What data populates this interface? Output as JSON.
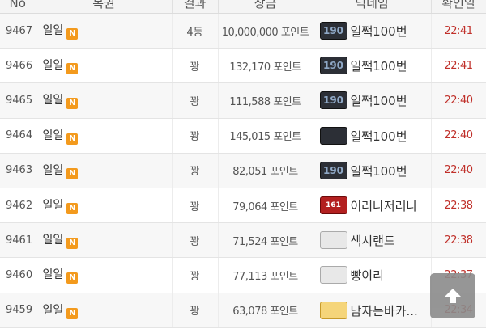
{
  "header": {
    "no": "No",
    "lottery": "복권",
    "result": "결과",
    "prize": "상금",
    "nickname": "닉네임",
    "confirm_time": "확인일"
  },
  "rows": [
    {
      "no": "9467",
      "lottery": "일일",
      "badge": "N",
      "result": "4등",
      "prize": "10,000,000 포인트",
      "level_icon": "level-190-dark",
      "nickname": "일짹100번",
      "time": "22:41"
    },
    {
      "no": "9466",
      "lottery": "일일",
      "badge": "N",
      "result": "꽝",
      "prize": "132,170 포인트",
      "level_icon": "level-190-dark",
      "nickname": "일짹100번",
      "time": "22:41"
    },
    {
      "no": "9465",
      "lottery": "일일",
      "badge": "N",
      "result": "꽝",
      "prize": "111,588 포인트",
      "level_icon": "level-190-dark",
      "nickname": "일짹100번",
      "time": "22:40"
    },
    {
      "no": "9464",
      "lottery": "일일",
      "badge": "N",
      "result": "꽝",
      "prize": "145,015 포인트",
      "level_icon": "level-dark",
      "nickname": "일짹100번",
      "time": "22:40"
    },
    {
      "no": "9463",
      "lottery": "일일",
      "badge": "N",
      "result": "꽝",
      "prize": "82,051 포인트",
      "level_icon": "level-190-dark",
      "nickname": "일짹100번",
      "time": "22:40"
    },
    {
      "no": "9462",
      "lottery": "일일",
      "badge": "N",
      "result": "꽝",
      "prize": "79,064 포인트",
      "level_icon": "level-161-red",
      "nickname": "이러나저러나",
      "time": "22:38"
    },
    {
      "no": "9461",
      "lottery": "일일",
      "badge": "N",
      "result": "꽝",
      "prize": "71,524 포인트",
      "level_icon": "level-gray",
      "nickname": "섹시랜드",
      "time": "22:38"
    },
    {
      "no": "9460",
      "lottery": "일일",
      "badge": "N",
      "result": "꽝",
      "prize": "77,113 포인트",
      "level_icon": "level-gray",
      "nickname": "빵이리",
      "time": "22:37"
    },
    {
      "no": "9459",
      "lottery": "일일",
      "badge": "N",
      "result": "꽝",
      "prize": "63,078 포인트",
      "level_icon": "level-gold",
      "nickname": "남자는바카...",
      "time": "22:34"
    }
  ],
  "colors": {
    "badge": "#f39a1d",
    "time_text": "#c0302a",
    "row_alt": "#f7f7f7",
    "scroll_button": "#8b8b8b"
  },
  "scroll_top_icon": "arrow-up-icon"
}
